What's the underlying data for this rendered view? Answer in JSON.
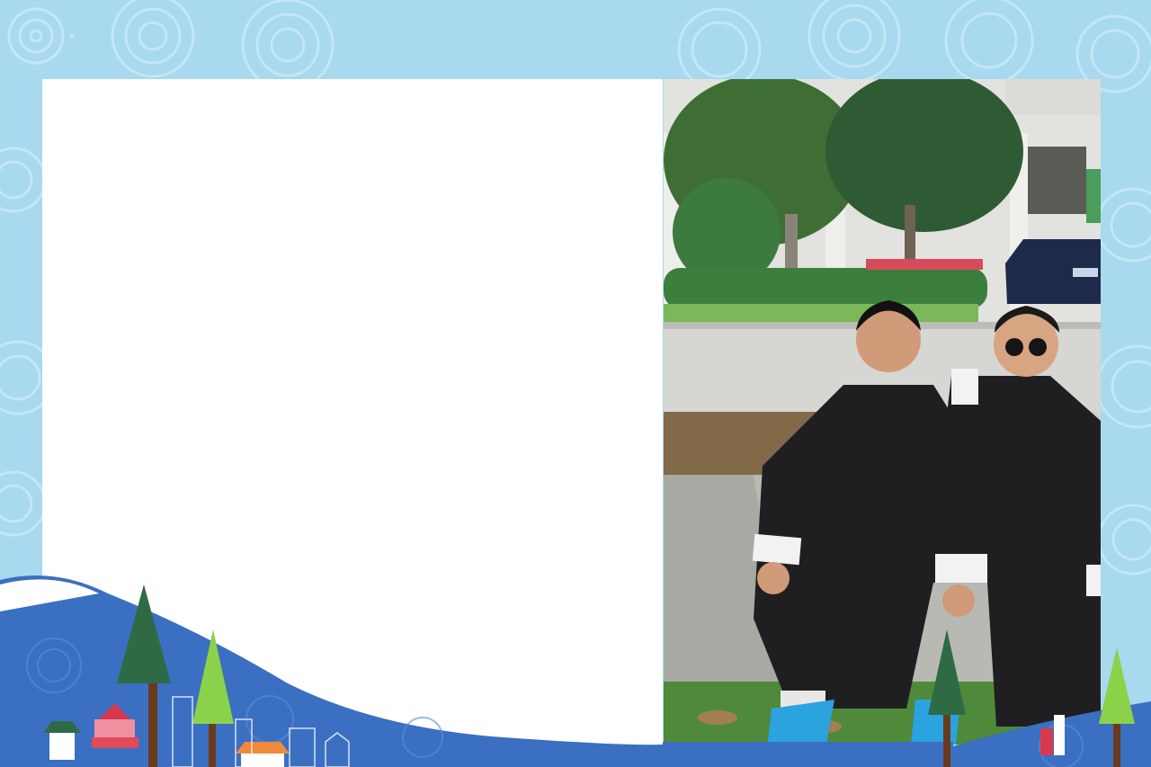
{
  "scene": {
    "background_color": "#a8d9ee",
    "wave_color": "#3b6fc1",
    "swirl_color": "#c6e8f6",
    "panel_color": "#ffffff",
    "robe_color": "#1f1f22",
    "cuff_color": "#f2f2f2",
    "shoe_color": "#2aa3df",
    "tree_dark": "#2e6b45",
    "tree_light": "#8bd24a"
  },
  "icons": {
    "decor_trees": "tree-icon",
    "decor_houses": "house-icon",
    "person": "person-icon",
    "car": "car-icon"
  }
}
